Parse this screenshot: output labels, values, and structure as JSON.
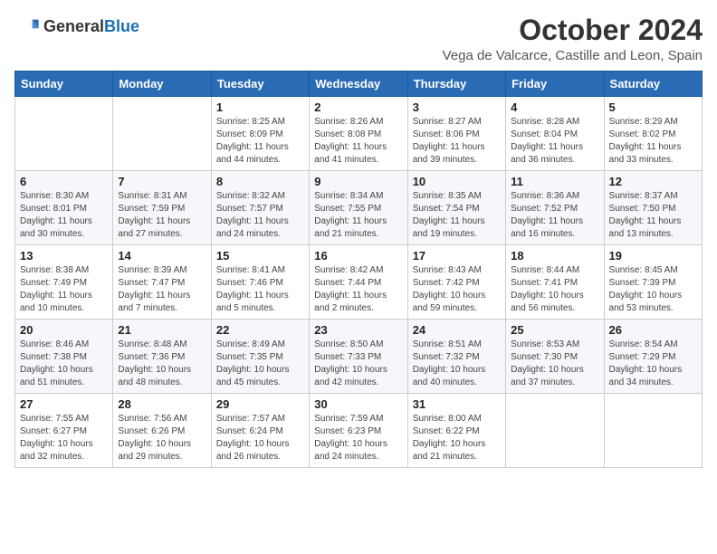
{
  "header": {
    "logo_general": "General",
    "logo_blue": "Blue",
    "month_title": "October 2024",
    "location": "Vega de Valcarce, Castille and Leon, Spain"
  },
  "weekdays": [
    "Sunday",
    "Monday",
    "Tuesday",
    "Wednesday",
    "Thursday",
    "Friday",
    "Saturday"
  ],
  "weeks": [
    [
      {
        "day": "",
        "info": ""
      },
      {
        "day": "",
        "info": ""
      },
      {
        "day": "1",
        "info": "Sunrise: 8:25 AM\nSunset: 8:09 PM\nDaylight: 11 hours and 44 minutes."
      },
      {
        "day": "2",
        "info": "Sunrise: 8:26 AM\nSunset: 8:08 PM\nDaylight: 11 hours and 41 minutes."
      },
      {
        "day": "3",
        "info": "Sunrise: 8:27 AM\nSunset: 8:06 PM\nDaylight: 11 hours and 39 minutes."
      },
      {
        "day": "4",
        "info": "Sunrise: 8:28 AM\nSunset: 8:04 PM\nDaylight: 11 hours and 36 minutes."
      },
      {
        "day": "5",
        "info": "Sunrise: 8:29 AM\nSunset: 8:02 PM\nDaylight: 11 hours and 33 minutes."
      }
    ],
    [
      {
        "day": "6",
        "info": "Sunrise: 8:30 AM\nSunset: 8:01 PM\nDaylight: 11 hours and 30 minutes."
      },
      {
        "day": "7",
        "info": "Sunrise: 8:31 AM\nSunset: 7:59 PM\nDaylight: 11 hours and 27 minutes."
      },
      {
        "day": "8",
        "info": "Sunrise: 8:32 AM\nSunset: 7:57 PM\nDaylight: 11 hours and 24 minutes."
      },
      {
        "day": "9",
        "info": "Sunrise: 8:34 AM\nSunset: 7:55 PM\nDaylight: 11 hours and 21 minutes."
      },
      {
        "day": "10",
        "info": "Sunrise: 8:35 AM\nSunset: 7:54 PM\nDaylight: 11 hours and 19 minutes."
      },
      {
        "day": "11",
        "info": "Sunrise: 8:36 AM\nSunset: 7:52 PM\nDaylight: 11 hours and 16 minutes."
      },
      {
        "day": "12",
        "info": "Sunrise: 8:37 AM\nSunset: 7:50 PM\nDaylight: 11 hours and 13 minutes."
      }
    ],
    [
      {
        "day": "13",
        "info": "Sunrise: 8:38 AM\nSunset: 7:49 PM\nDaylight: 11 hours and 10 minutes."
      },
      {
        "day": "14",
        "info": "Sunrise: 8:39 AM\nSunset: 7:47 PM\nDaylight: 11 hours and 7 minutes."
      },
      {
        "day": "15",
        "info": "Sunrise: 8:41 AM\nSunset: 7:46 PM\nDaylight: 11 hours and 5 minutes."
      },
      {
        "day": "16",
        "info": "Sunrise: 8:42 AM\nSunset: 7:44 PM\nDaylight: 11 hours and 2 minutes."
      },
      {
        "day": "17",
        "info": "Sunrise: 8:43 AM\nSunset: 7:42 PM\nDaylight: 10 hours and 59 minutes."
      },
      {
        "day": "18",
        "info": "Sunrise: 8:44 AM\nSunset: 7:41 PM\nDaylight: 10 hours and 56 minutes."
      },
      {
        "day": "19",
        "info": "Sunrise: 8:45 AM\nSunset: 7:39 PM\nDaylight: 10 hours and 53 minutes."
      }
    ],
    [
      {
        "day": "20",
        "info": "Sunrise: 8:46 AM\nSunset: 7:38 PM\nDaylight: 10 hours and 51 minutes."
      },
      {
        "day": "21",
        "info": "Sunrise: 8:48 AM\nSunset: 7:36 PM\nDaylight: 10 hours and 48 minutes."
      },
      {
        "day": "22",
        "info": "Sunrise: 8:49 AM\nSunset: 7:35 PM\nDaylight: 10 hours and 45 minutes."
      },
      {
        "day": "23",
        "info": "Sunrise: 8:50 AM\nSunset: 7:33 PM\nDaylight: 10 hours and 42 minutes."
      },
      {
        "day": "24",
        "info": "Sunrise: 8:51 AM\nSunset: 7:32 PM\nDaylight: 10 hours and 40 minutes."
      },
      {
        "day": "25",
        "info": "Sunrise: 8:53 AM\nSunset: 7:30 PM\nDaylight: 10 hours and 37 minutes."
      },
      {
        "day": "26",
        "info": "Sunrise: 8:54 AM\nSunset: 7:29 PM\nDaylight: 10 hours and 34 minutes."
      }
    ],
    [
      {
        "day": "27",
        "info": "Sunrise: 7:55 AM\nSunset: 6:27 PM\nDaylight: 10 hours and 32 minutes."
      },
      {
        "day": "28",
        "info": "Sunrise: 7:56 AM\nSunset: 6:26 PM\nDaylight: 10 hours and 29 minutes."
      },
      {
        "day": "29",
        "info": "Sunrise: 7:57 AM\nSunset: 6:24 PM\nDaylight: 10 hours and 26 minutes."
      },
      {
        "day": "30",
        "info": "Sunrise: 7:59 AM\nSunset: 6:23 PM\nDaylight: 10 hours and 24 minutes."
      },
      {
        "day": "31",
        "info": "Sunrise: 8:00 AM\nSunset: 6:22 PM\nDaylight: 10 hours and 21 minutes."
      },
      {
        "day": "",
        "info": ""
      },
      {
        "day": "",
        "info": ""
      }
    ]
  ]
}
